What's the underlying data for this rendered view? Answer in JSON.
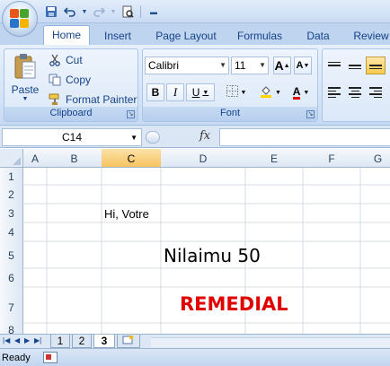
{
  "quick_access": {
    "save_icon": "save-icon",
    "undo_icon": "undo-icon",
    "redo_icon": "redo-icon",
    "print_preview_icon": "print-preview-icon",
    "customize_icon": "customize-icon"
  },
  "ribbon_tabs": [
    {
      "label": "Home",
      "active": true
    },
    {
      "label": "Insert",
      "active": false
    },
    {
      "label": "Page Layout",
      "active": false
    },
    {
      "label": "Formulas",
      "active": false
    },
    {
      "label": "Data",
      "active": false
    },
    {
      "label": "Review",
      "active": false
    }
  ],
  "clipboard": {
    "paste_label": "Paste",
    "cut_label": "Cut",
    "copy_label": "Copy",
    "format_painter_label": "Format Painter",
    "group_label": "Clipboard"
  },
  "font": {
    "name": "Calibri",
    "size": "11",
    "grow_label": "A",
    "shrink_label": "A",
    "bold_label": "B",
    "italic_label": "I",
    "underline_label": "U",
    "font_color_label": "A",
    "group_label": "Font"
  },
  "formula_bar": {
    "name_box": "C14",
    "fx_label": "fx",
    "formula_value": ""
  },
  "grid": {
    "columns": [
      "A",
      "B",
      "C",
      "D",
      "E",
      "F",
      "G"
    ],
    "selected_column": "C",
    "rows": [
      "1",
      "2",
      "3",
      "4",
      "5",
      "6",
      "7",
      "8"
    ],
    "cells": {
      "b3": "Hi, Votre",
      "d5": "Nilaimu 50",
      "d7": "REMEDIAL"
    },
    "remedial_color": "#e00000"
  },
  "sheets": {
    "tabs": [
      "1",
      "2",
      "3"
    ],
    "active": "3"
  },
  "status": {
    "text": "Ready"
  }
}
